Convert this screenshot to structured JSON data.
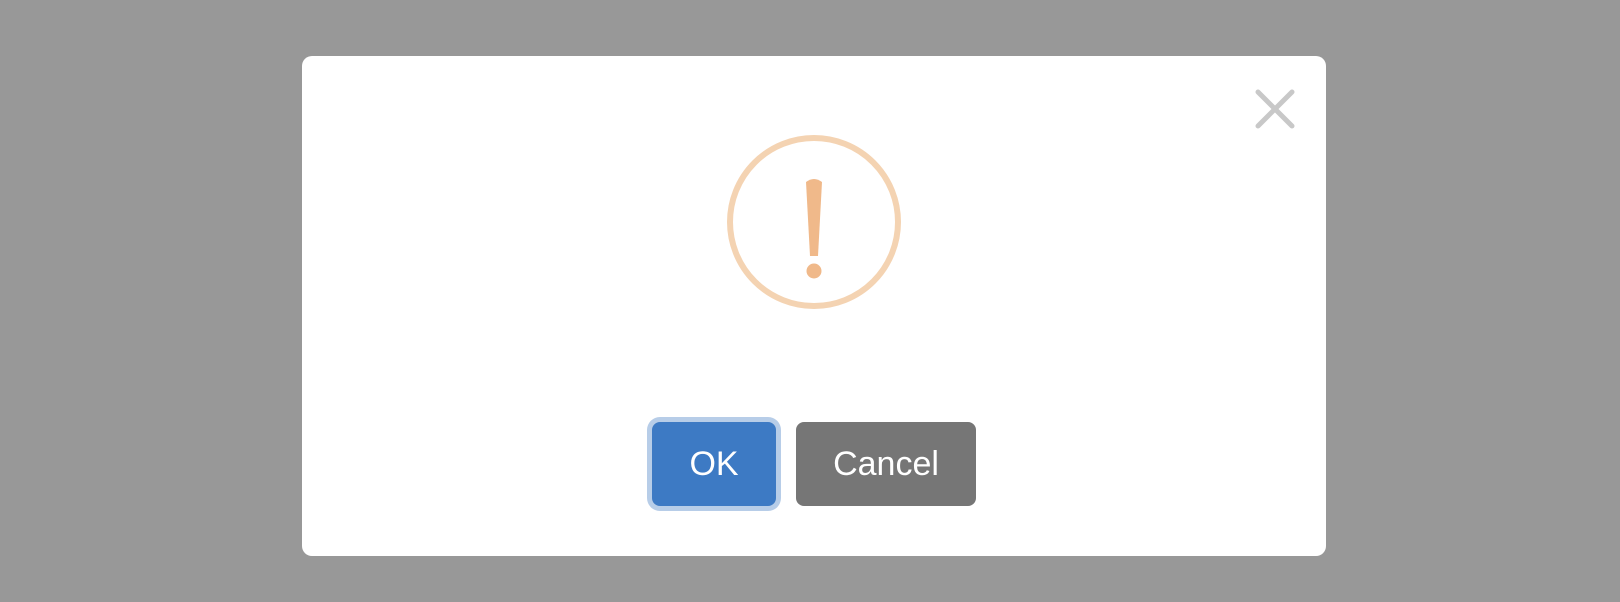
{
  "dialog": {
    "close_icon": "close-icon",
    "status_icon": "warning-exclamation-icon",
    "ok_label": "OK",
    "cancel_label": "Cancel"
  },
  "colors": {
    "overlay": "#989898",
    "dialog_background": "#ffffff",
    "warning_accent": "#f0b98a",
    "warning_ring": "#f4d3b2",
    "ok_button": "#3d7ac4",
    "ok_focus_ring": "#b7cde8",
    "cancel_button": "#767676",
    "close_icon": "#c8c8c8"
  }
}
